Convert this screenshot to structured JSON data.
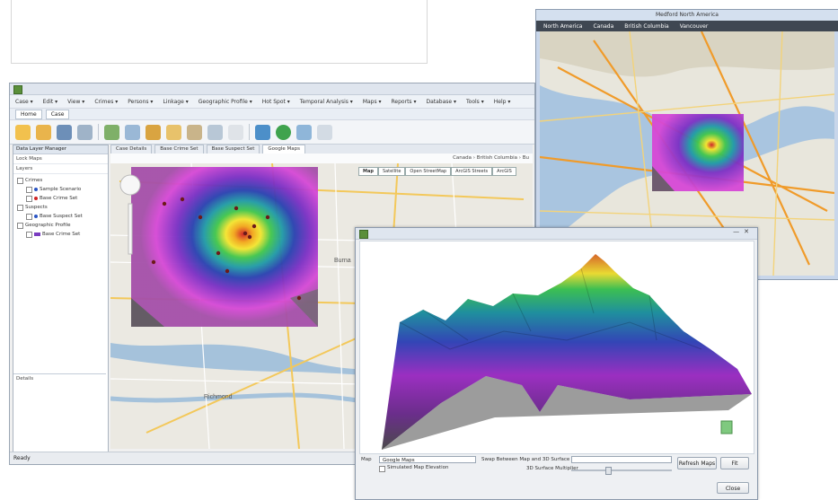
{
  "main_window": {
    "menus": [
      "Case ▾",
      "Edit ▾",
      "View ▾",
      "Crimes ▾",
      "Persons ▾",
      "Linkage ▾",
      "Geographic Profile ▾",
      "Hot Spot ▾",
      "Temporal Analysis ▾",
      "Maps ▾",
      "Reports ▾",
      "Database ▾",
      "Tools ▾",
      "Help ▾"
    ],
    "quick_tabs": [
      "Home",
      "Case"
    ],
    "left_panel": {
      "title": "Data Layer Manager",
      "subtitle": "Lock Maps",
      "section": "Layers",
      "tree": [
        {
          "label": "Crimes",
          "level": 0,
          "color": ""
        },
        {
          "label": "Sample Scenario",
          "level": 1,
          "color": "#2a55c4"
        },
        {
          "label": "Base Crime Set",
          "level": 1,
          "color": "#d02323"
        },
        {
          "label": "Suspects",
          "level": 0,
          "color": ""
        },
        {
          "label": "Base Suspect Set",
          "level": 1,
          "color": "#2a55c4"
        },
        {
          "label": "Geographic Profile",
          "level": 0,
          "color": ""
        },
        {
          "label": "Base Crime Set",
          "level": 1,
          "color": "#7a3cc0"
        }
      ],
      "details_label": "Details"
    },
    "doc_tabs": [
      "Case Details",
      "Base Crime Set",
      "Base Suspect Set",
      "Google Maps"
    ],
    "breadcrumb": "Canada › British Columbia › Bu",
    "map_tabs": [
      "Map",
      "Satellite",
      "Open StreetMap",
      "ArcGIS Streets",
      "ArcGIS"
    ],
    "map_labels": {
      "city_south": "Richmond",
      "city_east": "Burna"
    },
    "status": "Ready"
  },
  "overview_window": {
    "title": "Medford North America",
    "breadcrumbs": [
      "North America",
      "Canada",
      "British Columbia",
      "Vancouver"
    ]
  },
  "surface_window": {
    "map_label": "Map",
    "map_select": "Google Maps",
    "swap_label": "Swap Between Map and 3D Surface",
    "checkbox_label": "Simulated Map Elevation",
    "multiplier_label": "3D Surface Multiplier",
    "refresh_button": "Refresh Maps",
    "fit_button": "Fit",
    "close_button": "Close"
  }
}
